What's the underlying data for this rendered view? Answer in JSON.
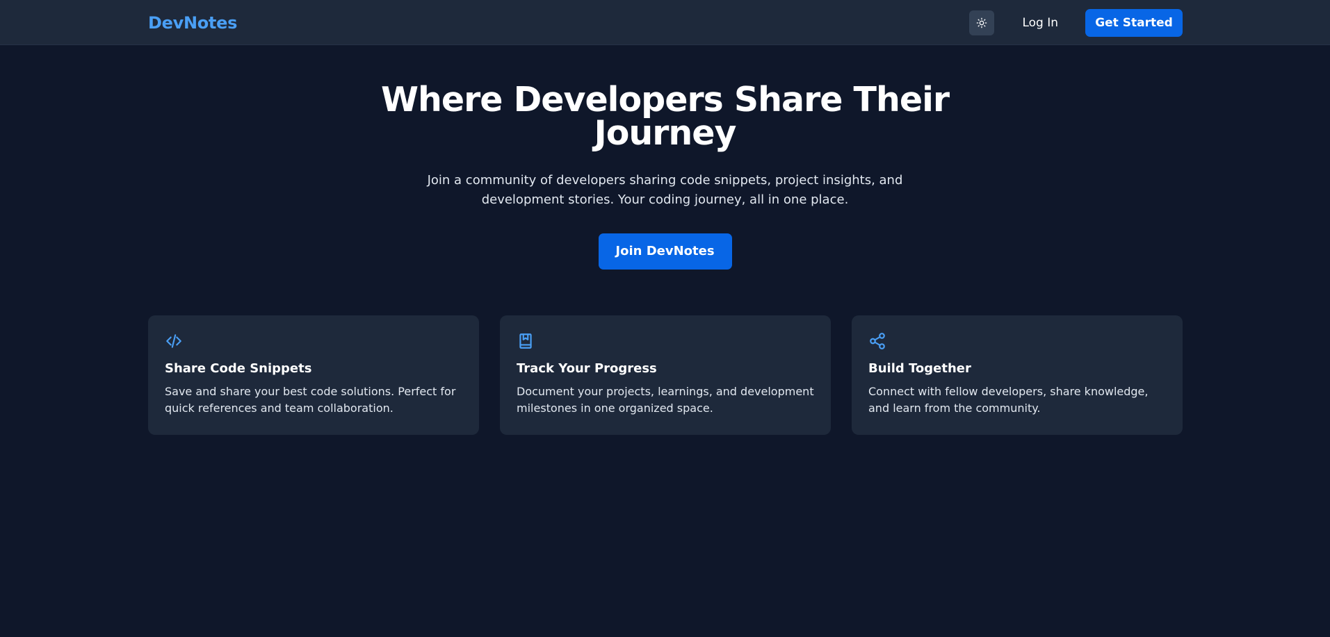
{
  "header": {
    "brand": "DevNotes",
    "theme_toggle_icon": "sun-icon",
    "login_label": "Log In",
    "get_started_label": "Get Started"
  },
  "hero": {
    "title": "Where Developers Share Their Journey",
    "subtitle": "Join a community of developers sharing code snippets, project insights, and development stories. Your coding journey, all in one place.",
    "cta_label": "Join DevNotes"
  },
  "features": [
    {
      "icon": "code-icon",
      "title": "Share Code Snippets",
      "description": "Save and share your best code solutions. Perfect for quick references and team collaboration."
    },
    {
      "icon": "bookmark-book-icon",
      "title": "Track Your Progress",
      "description": "Document your projects, learnings, and development milestones in one organized space."
    },
    {
      "icon": "share-icon",
      "title": "Build Together",
      "description": "Connect with fellow developers, share knowledge, and learn from the community."
    }
  ],
  "colors": {
    "background": "#0f172a",
    "surface": "#1e293b",
    "accent": "#0866e6",
    "brand": "#4a9ff5",
    "icon": "#4a9ff5"
  }
}
